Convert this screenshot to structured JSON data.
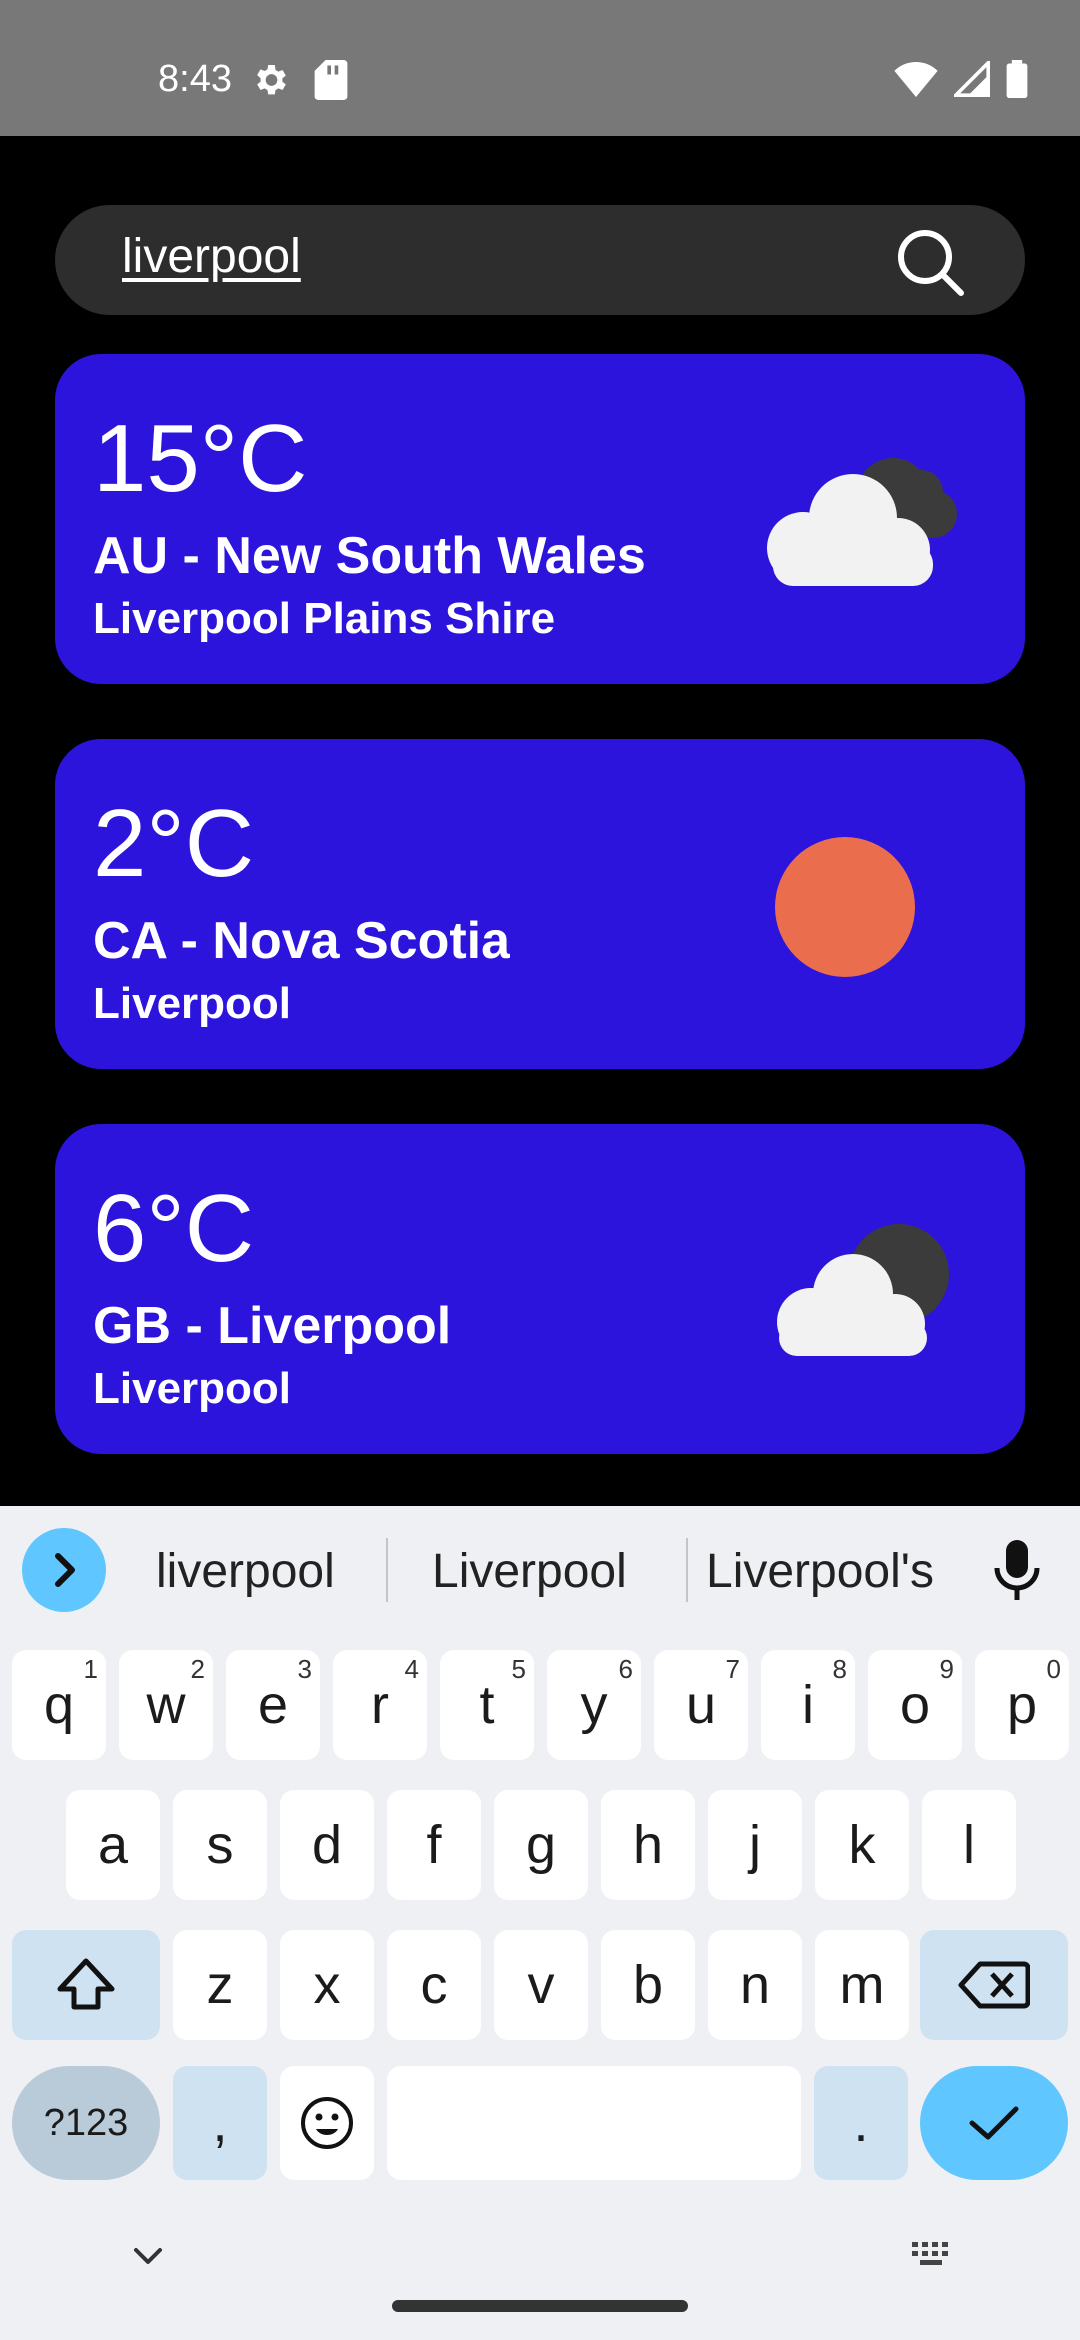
{
  "status_bar": {
    "time": "8:43",
    "icons": [
      "settings-gear-icon",
      "sd-card-icon",
      "wifi-icon",
      "signal-icon",
      "battery-icon"
    ]
  },
  "search": {
    "value": "liverpool",
    "icon": "search-icon"
  },
  "results": [
    {
      "temperature": "15°C",
      "region": "AU - New South Wales",
      "city": "Liverpool Plains Shire",
      "weather_icon": "cloudy-night-icon"
    },
    {
      "temperature": "2°C",
      "region": "CA - Nova Scotia",
      "city": "Liverpool",
      "weather_icon": "sun-icon"
    },
    {
      "temperature": "6°C",
      "region": "GB - Liverpool",
      "city": "Liverpool",
      "weather_icon": "partly-cloudy-night-icon"
    }
  ],
  "colors": {
    "card": "#2c14dc",
    "sun": "#ea6e4e",
    "accent": "#5fc6ff"
  },
  "keyboard": {
    "suggestions": [
      "liverpool",
      "Liverpool",
      "Liverpool's"
    ],
    "row1": [
      "q",
      "w",
      "e",
      "r",
      "t",
      "y",
      "u",
      "i",
      "o",
      "p"
    ],
    "row1_numbers": [
      "1",
      "2",
      "3",
      "4",
      "5",
      "6",
      "7",
      "8",
      "9",
      "0"
    ],
    "row2": [
      "a",
      "s",
      "d",
      "f",
      "g",
      "h",
      "j",
      "k",
      "l"
    ],
    "row3": [
      "z",
      "x",
      "c",
      "v",
      "b",
      "n",
      "m"
    ],
    "symbols_label": "?123",
    "comma": ",",
    "period": "."
  }
}
